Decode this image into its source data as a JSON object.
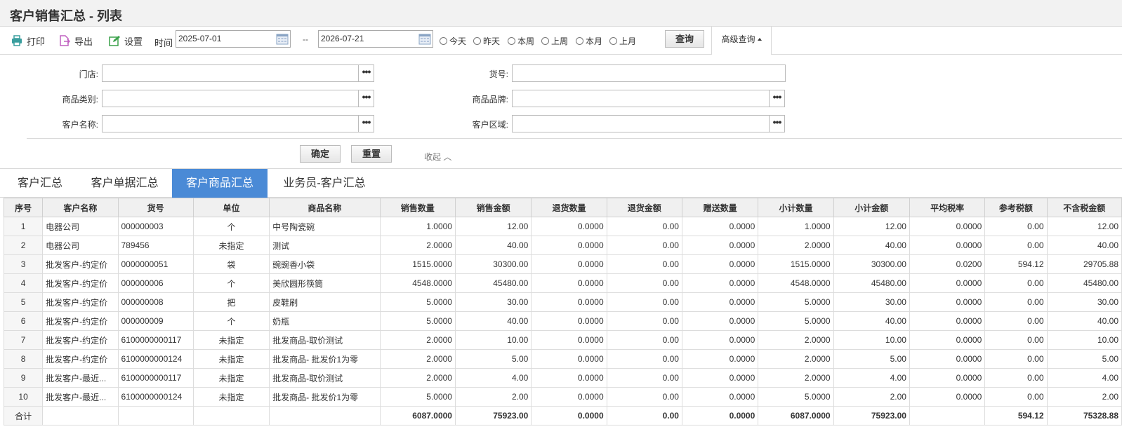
{
  "title": "客户销售汇总 - 列表",
  "toolbar": {
    "print_label": "打印",
    "export_label": "导出",
    "settings_label": "设置",
    "time_label": "时间",
    "date_from": "2025-07-01",
    "date_sep": "--",
    "date_to": "2026-07-21",
    "ranges": [
      "今天",
      "昨天",
      "本周",
      "上周",
      "本月",
      "上月"
    ],
    "query_label": "查询",
    "advanced_label": "高级查询"
  },
  "filters": {
    "store_label": "门店:",
    "item_no_label": "货号:",
    "category_label": "商品类别:",
    "brand_label": "商品品牌:",
    "customer_label": "客户名称:",
    "region_label": "客户区域:",
    "more_glyph": "•••",
    "confirm_label": "确定",
    "reset_label": "重置",
    "collapse_label": "收起 ︿"
  },
  "tabs": [
    "客户汇总",
    "客户单据汇总",
    "客户商品汇总",
    "业务员-客户汇总"
  ],
  "active_tab": 2,
  "table": {
    "headers": [
      "序号",
      "客户名称",
      "货号",
      "单位",
      "商品名称",
      "销售数量",
      "销售金额",
      "退货数量",
      "退货金额",
      "赠送数量",
      "小计数量",
      "小计金额",
      "平均税率",
      "参考税额",
      "不含税金额"
    ],
    "rows": [
      [
        "1",
        "电器公司",
        "000000003",
        "个",
        "中号陶瓷碗",
        "1.0000",
        "12.00",
        "0.0000",
        "0.00",
        "0.0000",
        "1.0000",
        "12.00",
        "0.0000",
        "0.00",
        "12.00"
      ],
      [
        "2",
        "电器公司",
        "789456",
        "未指定",
        "测试",
        "2.0000",
        "40.00",
        "0.0000",
        "0.00",
        "0.0000",
        "2.0000",
        "40.00",
        "0.0000",
        "0.00",
        "40.00"
      ],
      [
        "3",
        "批发客户-约定价",
        "0000000051",
        "袋",
        "豌豌香小袋",
        "1515.0000",
        "30300.00",
        "0.0000",
        "0.00",
        "0.0000",
        "1515.0000",
        "30300.00",
        "0.0200",
        "594.12",
        "29705.88"
      ],
      [
        "4",
        "批发客户-约定价",
        "000000006",
        "个",
        "美欣圆形筷筒",
        "4548.0000",
        "45480.00",
        "0.0000",
        "0.00",
        "0.0000",
        "4548.0000",
        "45480.00",
        "0.0000",
        "0.00",
        "45480.00"
      ],
      [
        "5",
        "批发客户-约定价",
        "000000008",
        "把",
        "皮鞋刷",
        "5.0000",
        "30.00",
        "0.0000",
        "0.00",
        "0.0000",
        "5.0000",
        "30.00",
        "0.0000",
        "0.00",
        "30.00"
      ],
      [
        "6",
        "批发客户-约定价",
        "000000009",
        "个",
        "奶瓶",
        "5.0000",
        "40.00",
        "0.0000",
        "0.00",
        "0.0000",
        "5.0000",
        "40.00",
        "0.0000",
        "0.00",
        "40.00"
      ],
      [
        "7",
        "批发客户-约定价",
        "6100000000117",
        "未指定",
        "批发商品-取价测试",
        "2.0000",
        "10.00",
        "0.0000",
        "0.00",
        "0.0000",
        "2.0000",
        "10.00",
        "0.0000",
        "0.00",
        "10.00"
      ],
      [
        "8",
        "批发客户-约定价",
        "6100000000124",
        "未指定",
        "批发商品- 批发价1为零",
        "2.0000",
        "5.00",
        "0.0000",
        "0.00",
        "0.0000",
        "2.0000",
        "5.00",
        "0.0000",
        "0.00",
        "5.00"
      ],
      [
        "9",
        "批发客户-最近...",
        "6100000000117",
        "未指定",
        "批发商品-取价测试",
        "2.0000",
        "4.00",
        "0.0000",
        "0.00",
        "0.0000",
        "2.0000",
        "4.00",
        "0.0000",
        "0.00",
        "4.00"
      ],
      [
        "10",
        "批发客户-最近...",
        "6100000000124",
        "未指定",
        "批发商品- 批发价1为零",
        "5.0000",
        "2.00",
        "0.0000",
        "0.00",
        "0.0000",
        "5.0000",
        "2.00",
        "0.0000",
        "0.00",
        "2.00"
      ]
    ],
    "total": [
      "合计",
      "",
      "",
      "",
      "",
      "6087.0000",
      "75923.00",
      "0.0000",
      "0.00",
      "0.0000",
      "6087.0000",
      "75923.00",
      "",
      "594.12",
      "75328.88"
    ]
  },
  "colors": {
    "accent": "#4a8ad6",
    "print_icon": "#3a9e9e",
    "export_icon": "#c060c0",
    "settings_icon": "#3aa14a"
  }
}
